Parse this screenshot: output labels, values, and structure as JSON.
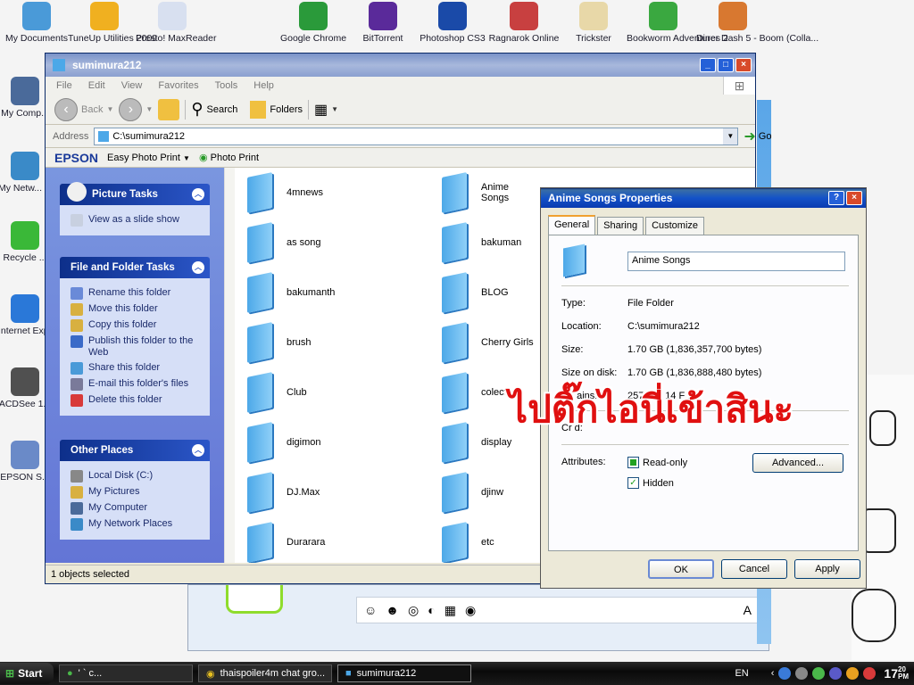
{
  "desktop": {
    "icons": [
      {
        "label": "My Documents",
        "icon": "folder-docs-icon",
        "color": "#4a9ad8"
      },
      {
        "label": "TuneUp Utilities 2009",
        "icon": "tuneup-icon",
        "color": "#f0b020"
      },
      {
        "label": "Presto! MaxReader",
        "icon": "presto-icon",
        "color": "#d8e0f0"
      },
      {
        "label": "Google Chrome",
        "icon": "chrome-icon",
        "color": "#2a9a3a"
      },
      {
        "label": "BitTorrent",
        "icon": "bittorrent-icon",
        "color": "#5a2a9a"
      },
      {
        "label": "Photoshop CS3",
        "icon": "photoshop-icon",
        "color": "#1a4aa8"
      },
      {
        "label": "Ragnarok Online",
        "icon": "ragnarok-icon",
        "color": "#c84040"
      },
      {
        "label": "Trickster",
        "icon": "trickster-icon",
        "color": "#e8d8a8"
      },
      {
        "label": "Bookworm Adventures 2",
        "icon": "bookworm-icon",
        "color": "#3aa840"
      },
      {
        "label": "Diner Dash 5 - Boom (Colla...",
        "icon": "dinerdash-icon",
        "color": "#d87830"
      }
    ],
    "left_icons": [
      {
        "label": "My Comp...",
        "icon": "my-computer-icon",
        "color": "#4a6a9a"
      },
      {
        "label": "My Netw... Places",
        "icon": "network-places-icon",
        "color": "#3a8ac8"
      },
      {
        "label": "Recycle ...",
        "icon": "recycle-bin-icon",
        "color": "#3ab838"
      },
      {
        "label": "Internet Explor...",
        "icon": "ie-icon",
        "color": "#2a78d8"
      },
      {
        "label": "ACDSee 1...",
        "icon": "acdsee-icon",
        "color": "#505050"
      },
      {
        "label": "EPSON S...",
        "icon": "epson-scan-icon",
        "color": "#6a8ac8"
      }
    ]
  },
  "explorer": {
    "title": "sumimura212",
    "menu": [
      "File",
      "Edit",
      "View",
      "Favorites",
      "Tools",
      "Help"
    ],
    "toolbar": {
      "back": "Back",
      "search": "Search",
      "folders": "Folders"
    },
    "address": {
      "label": "Address",
      "value": "C:\\sumimura212",
      "go": "Go"
    },
    "epson": {
      "brand": "EPSON",
      "easy_print": "Easy Photo Print",
      "photo_print": "Photo Print"
    },
    "panels": {
      "picture_tasks": {
        "title": "Picture Tasks",
        "items": [
          "View as a slide show"
        ]
      },
      "file_tasks": {
        "title": "File and Folder Tasks",
        "items": [
          "Rename this folder",
          "Move this folder",
          "Copy this folder",
          "Publish this folder to the Web",
          "Share this folder",
          "E-mail this folder's files",
          "Delete this folder"
        ]
      },
      "other_places": {
        "title": "Other Places",
        "items": [
          "Local Disk (C:)",
          "My Pictures",
          "My Computer",
          "My Network Places"
        ]
      }
    },
    "folders_col1": [
      "4mnews",
      "as song",
      "bakumanth",
      "brush",
      "Club",
      "digimon",
      "DJ.Max",
      "Durarara"
    ],
    "folders_col2": [
      "Anime Songs",
      "bakuman",
      "BLOG",
      "Cherry Girls",
      "colection",
      "display",
      "djinw",
      "etc"
    ],
    "status": "1 objects selected"
  },
  "dialog": {
    "title": "Anime Songs Properties",
    "tabs": [
      "General",
      "Sharing",
      "Customize"
    ],
    "name": "Anime Songs",
    "rows": [
      {
        "k": "Type:",
        "v": "File Folder"
      },
      {
        "k": "Location:",
        "v": "C:\\sumimura212"
      },
      {
        "k": "Size:",
        "v": "1.70 GB (1,836,357,700 bytes)"
      },
      {
        "k": "Size on disk:",
        "v": "1.70 GB (1,836,888,480 bytes)"
      },
      {
        "k": "Co   ains:",
        "v": "257 File   14 F   ers"
      }
    ],
    "created_label": "Cr      d:",
    "attributes_label": "Attributes:",
    "readonly": "Read-only",
    "hidden": "Hidden",
    "advanced": "Advanced...",
    "ok": "OK",
    "cancel": "Cancel",
    "apply": "Apply"
  },
  "overlay_text": "ไปติ๊กไอนี่เข้าสินะ",
  "taskbar": {
    "start": "Start",
    "tasks": [
      "'           `  c...",
      "thaispoiler4m chat gro...",
      "sumimura212"
    ],
    "lang": "EN",
    "clock": "17",
    "clock_min": "20",
    "clock_ampm": "PM"
  }
}
